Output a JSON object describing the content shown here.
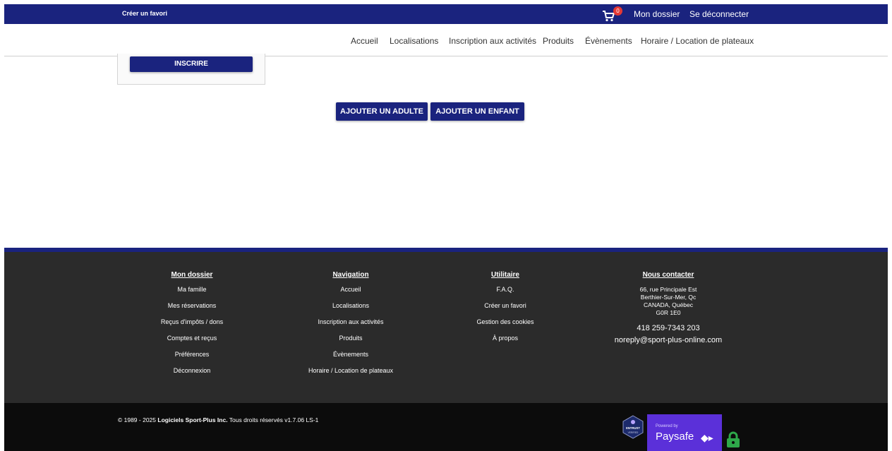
{
  "topbar": {
    "create_favorite": "Créer un favori",
    "cart_count": "0",
    "my_account": "Mon dossier",
    "logout": "Se déconnecter",
    "colors": {
      "bar": "#1a237e",
      "badge": "#e53935"
    }
  },
  "nav": {
    "items": [
      "Accueil",
      "Localisations",
      "Inscription aux activités",
      "Produits",
      "Évènements",
      "Horaire / Location de plateaux"
    ]
  },
  "main": {
    "register_button": "INSCRIRE",
    "add_adult_button": "AJOUTER UN ADULTE",
    "add_child_button": "AJOUTER UN ENFANT"
  },
  "footer": {
    "account": {
      "heading": "Mon dossier",
      "links": [
        "Ma famille",
        "Mes réservations",
        "Reçus d'impôts / dons",
        "Comptes et reçus",
        "Préférences",
        "Déconnexion"
      ]
    },
    "navigation": {
      "heading": "Navigation",
      "links": [
        "Accueil",
        "Localisations",
        "Inscription aux activités",
        "Produits",
        "Évènements",
        "Horaire / Location de plateaux"
      ]
    },
    "utility": {
      "heading": "Utilitaire",
      "links": [
        "F.A.Q.",
        "Créer un favori",
        "Gestion des cookies",
        "À propos"
      ]
    },
    "contact": {
      "heading": "Nous contacter",
      "address": [
        "66, rue Principale Est",
        "Berthier-Sur-Mer, Qc",
        "CANADA, Québec",
        "G0R 1E0"
      ],
      "phone": "418 259-7343 203",
      "email": "noreply@sport-plus-online.com"
    }
  },
  "bottom": {
    "copyright_prefix": "© 1989 - 2025",
    "company": "Logiciels Sport-Plus Inc.",
    "copyright_suffix": "Tous droits réservés v1.7.06 LS-1",
    "entrust_label": "ENTRUST",
    "entrust_sub": "VERIFIED",
    "paysafe_powered": "Powered by",
    "paysafe_name": "Paysafe",
    "paysafe_color": "#5b30d9",
    "lock_color": "#2ea84a"
  }
}
